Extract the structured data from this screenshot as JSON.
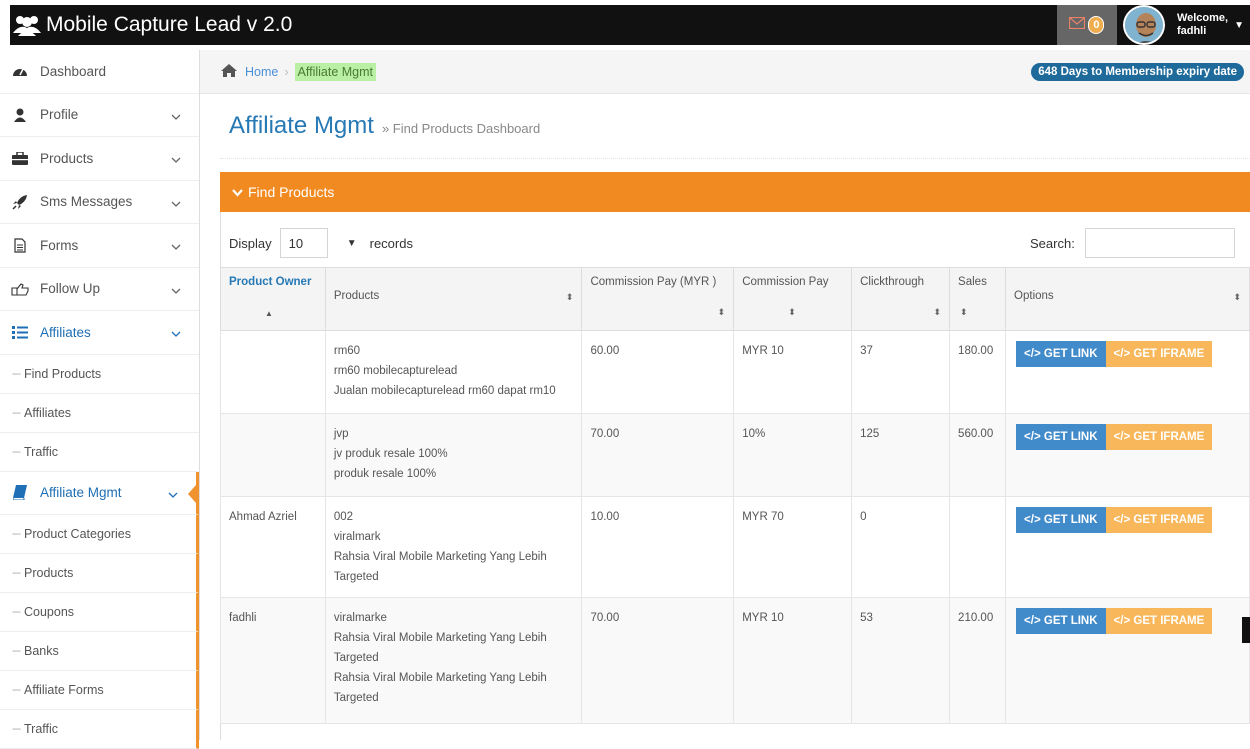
{
  "app": {
    "title": "Mobile Capture Lead v 2.0"
  },
  "topbar": {
    "mail_count": "0",
    "welcome_label": "Welcome,",
    "username": "fadhli"
  },
  "sidebar": {
    "items": [
      {
        "label": "Dashboard",
        "icon": "tachometer-icon"
      },
      {
        "label": "Profile",
        "icon": "user-icon"
      },
      {
        "label": "Products",
        "icon": "briefcase-icon"
      },
      {
        "label": "Sms Messages",
        "icon": "rocket-icon"
      },
      {
        "label": "Forms",
        "icon": "file-icon"
      },
      {
        "label": "Follow Up",
        "icon": "hand-point-icon"
      },
      {
        "label": "Affiliates",
        "icon": "list-icon"
      }
    ],
    "affiliates_sub": [
      "Find Products",
      "Affiliates",
      "Traffic"
    ],
    "affiliate_mgmt": {
      "label": "Affiliate Mgmt",
      "icon": "book-icon"
    },
    "mgmt_sub": [
      "Product Categories",
      "Products",
      "Coupons",
      "Banks",
      "Affiliate Forms",
      "Traffic"
    ]
  },
  "breadcrumb": {
    "home": "Home",
    "current": "Affiliate Mgmt",
    "expiry": "648 Days to Membership expiry date"
  },
  "page": {
    "title": "Affiliate Mgmt",
    "subtitle": "» Find Products Dashboard"
  },
  "widget": {
    "title": "Find Products"
  },
  "controls": {
    "display_label": "Display",
    "display_value": "10",
    "records_label": "records",
    "search_label": "Search:"
  },
  "table": {
    "headers": [
      "Product Owner",
      "Products",
      "Commission Pay (MYR )",
      "Commission Pay",
      "Clickthrough",
      "Sales",
      "Options"
    ],
    "rows": [
      {
        "owner": "",
        "products": [
          "rm60",
          "rm60 mobilecapturelead",
          "Jualan mobilecapturelead rm60 dapat rm10"
        ],
        "commission_myr": "60.00",
        "commission": "MYR 10",
        "clickthrough": "37",
        "sales": "180.00"
      },
      {
        "owner": "",
        "products": [
          "jvp",
          "jv produk resale 100%",
          "produk resale 100%"
        ],
        "commission_myr": "70.00",
        "commission": "10%",
        "clickthrough": "125",
        "sales": "560.00"
      },
      {
        "owner": "Ahmad Azriel",
        "products": [
          "002",
          "viralmark",
          "Rahsia Viral Mobile Marketing Yang Lebih",
          "Targeted"
        ],
        "commission_myr": "10.00",
        "commission": "MYR 70",
        "clickthrough": "0",
        "sales": ""
      },
      {
        "owner": "fadhli",
        "products": [
          "viralmarke",
          "Rahsia Viral Mobile Marketing Yang Lebih",
          "Targeted",
          "Rahsia Viral Mobile Marketing Yang Lebih",
          "Targeted"
        ],
        "commission_myr": "70.00",
        "commission": "MYR 10",
        "clickthrough": "53",
        "sales": "210.00"
      }
    ],
    "get_link_label": "GET LINK",
    "get_iframe_label": "GET IFRAME"
  },
  "colors": {
    "accent_orange": "#f28a22",
    "link_blue": "#2679b5",
    "button_blue": "#428bca",
    "button_orange": "#f7b75a",
    "highlight_green": "#b9f0a6"
  }
}
